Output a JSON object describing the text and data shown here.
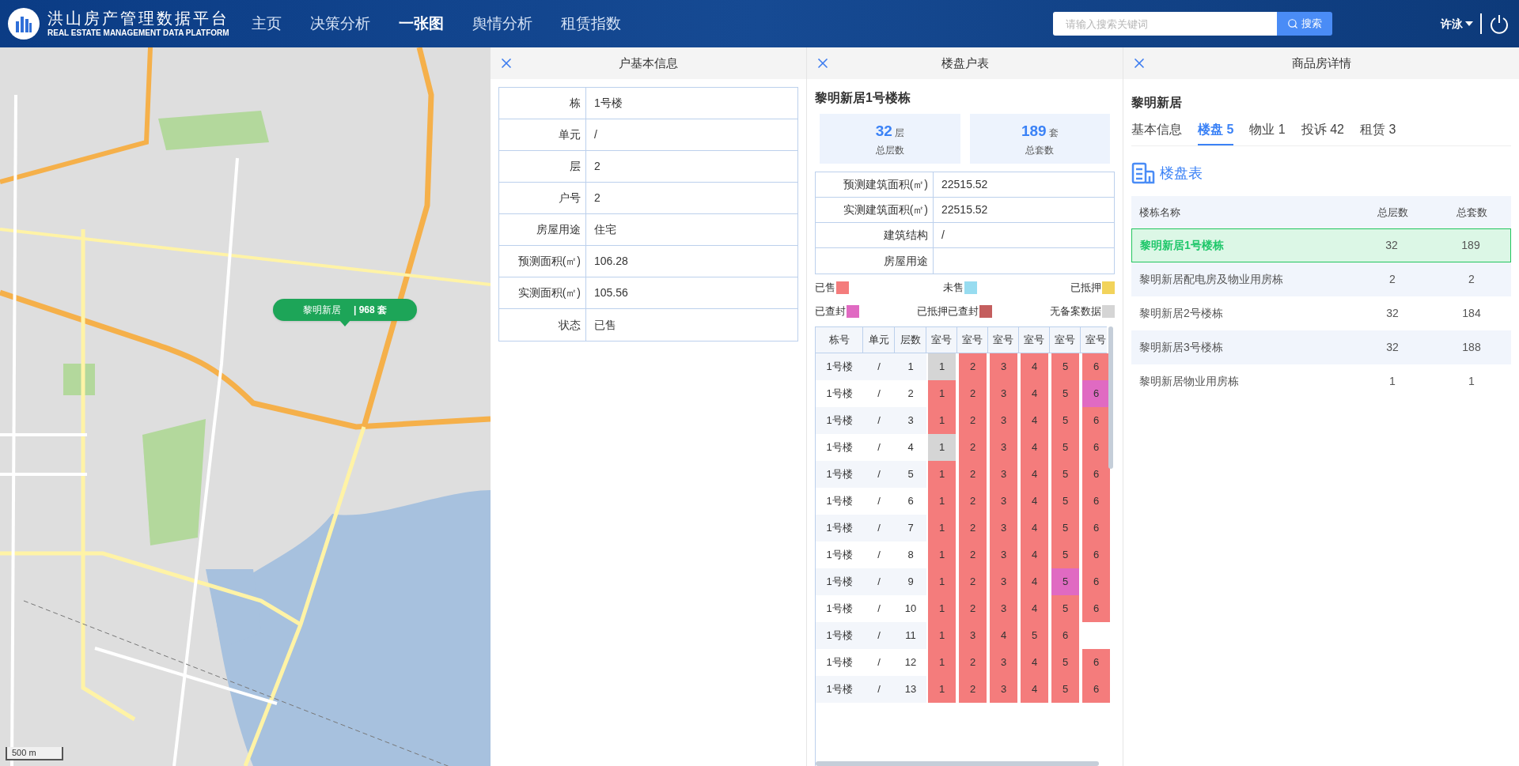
{
  "header": {
    "title": "洪山房产管理数据平台",
    "subtitle": "REAL ESTATE MANAGEMENT DATA PLATFORM",
    "nav": [
      {
        "label": "主页",
        "selected": false
      },
      {
        "label": "决策分析",
        "selected": false
      },
      {
        "label": "一张图",
        "selected": true
      },
      {
        "label": "舆情分析",
        "selected": false
      },
      {
        "label": "租赁指数",
        "selected": false
      }
    ],
    "search": {
      "placeholder": "请输入搜索关键词",
      "button": "搜索"
    },
    "user": "许泳"
  },
  "map": {
    "marker": {
      "name": "黎明新居",
      "count": "| 968 套"
    },
    "scale": "500 m"
  },
  "household_panel": {
    "title": "户基本信息",
    "fields": [
      {
        "label": "栋",
        "value": "1号楼"
      },
      {
        "label": "单元",
        "value": "/"
      },
      {
        "label": "层",
        "value": "2"
      },
      {
        "label": "户号",
        "value": "2"
      },
      {
        "label": "房屋用途",
        "value": "住宅"
      },
      {
        "label": "预测面积(㎡)",
        "value": "106.28"
      },
      {
        "label": "实测面积(㎡)",
        "value": "105.56"
      },
      {
        "label": "状态",
        "value": "已售"
      }
    ]
  },
  "units_panel": {
    "title": "楼盘户表",
    "building": "黎明新居1号楼栋",
    "stats": [
      {
        "value": "32",
        "unit": "层",
        "label": "总层数"
      },
      {
        "value": "189",
        "unit": "套",
        "label": "总套数"
      }
    ],
    "fields": [
      {
        "label": "预测建筑面积(㎡)",
        "value": "22515.52"
      },
      {
        "label": "实测建筑面积(㎡)",
        "value": "22515.52"
      },
      {
        "label": "建筑结构",
        "value": "/"
      },
      {
        "label": "房屋用途"
      }
    ],
    "legend": [
      {
        "label": "已售",
        "color": "#f47c7c"
      },
      {
        "label": "未售",
        "color": "#97dcf0"
      },
      {
        "label": "已抵押",
        "color": "#f2d35b"
      },
      {
        "label": "已查封",
        "color": "#e06ac2"
      },
      {
        "label": "已抵押已查封",
        "color": "#c45e5e"
      },
      {
        "label": "无备案数据",
        "color": "#d5d5d5"
      }
    ],
    "columns": [
      "栋号",
      "单元",
      "层数",
      "室号",
      "室号",
      "室号",
      "室号",
      "室号",
      "室号"
    ],
    "rows": [
      {
        "building": "1号楼",
        "unit": "/",
        "floor": "1",
        "rooms": [
          {
            "room": "1",
            "color": "#d5d5d5"
          },
          {
            "room": "2",
            "color": "#f47c7c"
          },
          {
            "room": "3",
            "color": "#f47c7c"
          },
          {
            "room": "4",
            "color": "#f47c7c"
          },
          {
            "room": "5",
            "color": "#f47c7c"
          },
          {
            "room": "6",
            "color": "#f47c7c"
          }
        ]
      },
      {
        "building": "1号楼",
        "unit": "/",
        "floor": "2",
        "rooms": [
          {
            "room": "1",
            "color": "#f47c7c"
          },
          {
            "room": "2",
            "color": "#f47c7c"
          },
          {
            "room": "3",
            "color": "#f47c7c"
          },
          {
            "room": "4",
            "color": "#f47c7c"
          },
          {
            "room": "5",
            "color": "#f47c7c"
          },
          {
            "room": "6",
            "color": "#e06ac2"
          }
        ]
      },
      {
        "building": "1号楼",
        "unit": "/",
        "floor": "3",
        "rooms": [
          {
            "room": "1",
            "color": "#f47c7c"
          },
          {
            "room": "2",
            "color": "#f47c7c"
          },
          {
            "room": "3",
            "color": "#f47c7c"
          },
          {
            "room": "4",
            "color": "#f47c7c"
          },
          {
            "room": "5",
            "color": "#f47c7c"
          },
          {
            "room": "6",
            "color": "#f47c7c"
          }
        ]
      },
      {
        "building": "1号楼",
        "unit": "/",
        "floor": "4",
        "rooms": [
          {
            "room": "1",
            "color": "#d5d5d5"
          },
          {
            "room": "2",
            "color": "#f47c7c"
          },
          {
            "room": "3",
            "color": "#f47c7c"
          },
          {
            "room": "4",
            "color": "#f47c7c"
          },
          {
            "room": "5",
            "color": "#f47c7c"
          },
          {
            "room": "6",
            "color": "#f47c7c"
          }
        ]
      },
      {
        "building": "1号楼",
        "unit": "/",
        "floor": "5",
        "rooms": [
          {
            "room": "1",
            "color": "#f47c7c"
          },
          {
            "room": "2",
            "color": "#f47c7c"
          },
          {
            "room": "3",
            "color": "#f47c7c"
          },
          {
            "room": "4",
            "color": "#f47c7c"
          },
          {
            "room": "5",
            "color": "#f47c7c"
          },
          {
            "room": "6",
            "color": "#f47c7c"
          }
        ]
      },
      {
        "building": "1号楼",
        "unit": "/",
        "floor": "6",
        "rooms": [
          {
            "room": "1",
            "color": "#f47c7c"
          },
          {
            "room": "2",
            "color": "#f47c7c"
          },
          {
            "room": "3",
            "color": "#f47c7c"
          },
          {
            "room": "4",
            "color": "#f47c7c"
          },
          {
            "room": "5",
            "color": "#f47c7c"
          },
          {
            "room": "6",
            "color": "#f47c7c"
          }
        ]
      },
      {
        "building": "1号楼",
        "unit": "/",
        "floor": "7",
        "rooms": [
          {
            "room": "1",
            "color": "#f47c7c"
          },
          {
            "room": "2",
            "color": "#f47c7c"
          },
          {
            "room": "3",
            "color": "#f47c7c"
          },
          {
            "room": "4",
            "color": "#f47c7c"
          },
          {
            "room": "5",
            "color": "#f47c7c"
          },
          {
            "room": "6",
            "color": "#f47c7c"
          }
        ]
      },
      {
        "building": "1号楼",
        "unit": "/",
        "floor": "8",
        "rooms": [
          {
            "room": "1",
            "color": "#f47c7c"
          },
          {
            "room": "2",
            "color": "#f47c7c"
          },
          {
            "room": "3",
            "color": "#f47c7c"
          },
          {
            "room": "4",
            "color": "#f47c7c"
          },
          {
            "room": "5",
            "color": "#f47c7c"
          },
          {
            "room": "6",
            "color": "#f47c7c"
          }
        ]
      },
      {
        "building": "1号楼",
        "unit": "/",
        "floor": "9",
        "rooms": [
          {
            "room": "1",
            "color": "#f47c7c"
          },
          {
            "room": "2",
            "color": "#f47c7c"
          },
          {
            "room": "3",
            "color": "#f47c7c"
          },
          {
            "room": "4",
            "color": "#f47c7c"
          },
          {
            "room": "5",
            "color": "#e06ac2"
          },
          {
            "room": "6",
            "color": "#f47c7c"
          }
        ]
      },
      {
        "building": "1号楼",
        "unit": "/",
        "floor": "10",
        "rooms": [
          {
            "room": "1",
            "color": "#f47c7c"
          },
          {
            "room": "2",
            "color": "#f47c7c"
          },
          {
            "room": "3",
            "color": "#f47c7c"
          },
          {
            "room": "4",
            "color": "#f47c7c"
          },
          {
            "room": "5",
            "color": "#f47c7c"
          },
          {
            "room": "6",
            "color": "#f47c7c"
          }
        ]
      },
      {
        "building": "1号楼",
        "unit": "/",
        "floor": "11",
        "rooms": [
          {
            "room": "1",
            "color": "#f47c7c"
          },
          {
            "room": "3",
            "color": "#f47c7c"
          },
          {
            "room": "4",
            "color": "#f47c7c"
          },
          {
            "room": "5",
            "color": "#f47c7c"
          },
          {
            "room": "6",
            "color": "#f47c7c"
          }
        ]
      },
      {
        "building": "1号楼",
        "unit": "/",
        "floor": "12",
        "rooms": [
          {
            "room": "1",
            "color": "#f47c7c"
          },
          {
            "room": "2",
            "color": "#f47c7c"
          },
          {
            "room": "3",
            "color": "#f47c7c"
          },
          {
            "room": "4",
            "color": "#f47c7c"
          },
          {
            "room": "5",
            "color": "#f47c7c"
          },
          {
            "room": "6",
            "color": "#f47c7c"
          }
        ]
      },
      {
        "building": "1号楼",
        "unit": "/",
        "floor": "13",
        "rooms": [
          {
            "room": "1",
            "color": "#f47c7c"
          },
          {
            "room": "2",
            "color": "#f47c7c"
          },
          {
            "room": "3",
            "color": "#f47c7c"
          },
          {
            "room": "4",
            "color": "#f47c7c"
          },
          {
            "room": "5",
            "color": "#f47c7c"
          },
          {
            "room": "6",
            "color": "#f47c7c"
          }
        ]
      }
    ]
  },
  "detail_panel": {
    "title": "商品房详情",
    "project": "黎明新居",
    "tabs": [
      {
        "label": "基本信息",
        "selected": false
      },
      {
        "label": "楼盘 5",
        "selected": true
      },
      {
        "label": "物业 1",
        "selected": false
      },
      {
        "label": "投诉 42",
        "selected": false
      },
      {
        "label": "租赁 3",
        "selected": false
      }
    ],
    "section": "楼盘表",
    "columns": [
      "楼栋名称",
      "总层数",
      "总套数"
    ],
    "rows": [
      {
        "name": "黎明新居1号楼栋",
        "floors": "32",
        "units": "189",
        "selected": true
      },
      {
        "name": "黎明新居配电房及物业用房栋",
        "floors": "2",
        "units": "2",
        "selected": false
      },
      {
        "name": "黎明新居2号楼栋",
        "floors": "32",
        "units": "184",
        "selected": false
      },
      {
        "name": "黎明新居3号楼栋",
        "floors": "32",
        "units": "188",
        "selected": false
      },
      {
        "name": "黎明新居物业用房栋",
        "floors": "1",
        "units": "1",
        "selected": false
      }
    ]
  }
}
